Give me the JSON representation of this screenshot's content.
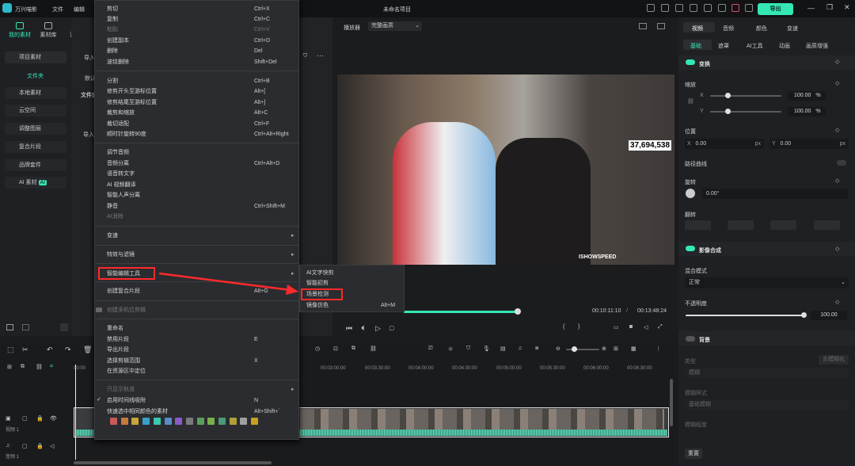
{
  "app": {
    "name": "万兴喵影",
    "menu_file": "文件",
    "menu_edit": "编辑",
    "project_title": "未命名项目",
    "export_label": "导出"
  },
  "left": {
    "tabs": [
      "我的素材",
      "素材库",
      "音频"
    ],
    "section": "项目素材",
    "folder": "文件夹",
    "items": [
      "本地素材",
      "云空间",
      "调整图层",
      "复合片段",
      "品牌套件",
      "AI 素材"
    ],
    "ai_badge": "AI"
  },
  "mid": {
    "import_label": "导入",
    "default_label": "默认",
    "folder_label": "文件夹",
    "import_btn": "导入"
  },
  "player": {
    "label": "播放器",
    "quality": "完整画质",
    "current_time": "00:10:11:10",
    "total_time": "00:13:48:24",
    "overlay_count": "37,694,538",
    "watermark": "ISHOWSPEED"
  },
  "right": {
    "tabs": [
      "视频",
      "音频",
      "颜色",
      "变速"
    ],
    "subtabs": [
      "基础",
      "遮罩",
      "AI工具",
      "动画",
      "画质增强"
    ],
    "transform": "变换",
    "scale": "缩放",
    "x_label": "X",
    "y_label": "Y",
    "scale_x": "100.00",
    "scale_y": "100.00",
    "pct": "%",
    "position": "位置",
    "pos_x": "0.00",
    "pos_y": "0.00",
    "px": "px",
    "path_curve": "路径曲线",
    "rotate": "旋转",
    "rotate_val": "0.00°",
    "flip": "翻转",
    "blend": "影像合成",
    "blend_mode_label": "混合模式",
    "blend_mode": "正常",
    "opacity_label": "不透明度",
    "opacity": "100.00",
    "opacity_frac": 1.0,
    "scale_frac": 0.25,
    "background": "背景",
    "bg_type": "类型",
    "bg_type_val": "模糊",
    "bg_type_btn": "去模糊化",
    "bg_style_label": "模糊样式",
    "bg_style": "基础模糊",
    "bg_level": "模糊程度",
    "reset": "重置"
  },
  "timeline": {
    "ruler": [
      "00:00",
      "00:03:00:00",
      "00:03:30:00",
      "00:04:00:00",
      "00:04:30:00",
      "00:05:00:00",
      "00:05:30:00",
      "00:06:00:00",
      "00:06:30:00"
    ],
    "video_track": "视频 1",
    "audio_track": "音频 1"
  },
  "context_menu": {
    "items": [
      {
        "label": "剪切",
        "shortcut": "Ctrl+X",
        "disabled": false
      },
      {
        "label": "复制",
        "shortcut": "Ctrl+C",
        "disabled": false
      },
      {
        "label": "粘贴",
        "shortcut": "Ctrl+V",
        "disabled": true
      },
      {
        "label": "创建副本",
        "shortcut": "Ctrl+D",
        "disabled": false
      },
      {
        "label": "删除",
        "shortcut": "Del",
        "disabled": false
      },
      {
        "label": "波纹删除",
        "shortcut": "Shift+Del",
        "disabled": false
      },
      {
        "label": "分割",
        "shortcut": "Ctrl+B",
        "disabled": false
      },
      {
        "label": "修剪开头至游标位置",
        "shortcut": "Alt+[",
        "disabled": false
      },
      {
        "label": "修剪结尾至游标位置",
        "shortcut": "Alt+]",
        "disabled": false
      },
      {
        "label": "裁剪和缩放",
        "shortcut": "Alt+C",
        "disabled": false
      },
      {
        "label": "裁切适配",
        "shortcut": "Ctrl+F",
        "disabled": false
      },
      {
        "label": "顺时针旋转90度",
        "shortcut": "Ctrl+Alt+Right",
        "disabled": false
      },
      {
        "label": "调节音频",
        "shortcut": "",
        "disabled": false
      },
      {
        "label": "音频分离",
        "shortcut": "Ctrl+Alt+D",
        "disabled": false
      },
      {
        "label": "语音转文字",
        "shortcut": "",
        "disabled": false
      },
      {
        "label": "AI 视频翻译",
        "shortcut": "",
        "disabled": false
      },
      {
        "label": "智能人声分离",
        "shortcut": "",
        "disabled": false
      },
      {
        "label": "静音",
        "shortcut": "Ctrl+Shift+M",
        "disabled": false
      },
      {
        "label": "AI消除",
        "shortcut": "",
        "disabled": true
      },
      {
        "label": "变速",
        "shortcut": "",
        "disabled": false
      },
      {
        "label": "特效与滤镜",
        "shortcut": "",
        "disabled": false
      },
      {
        "label": "智能编辑工具",
        "shortcut": "",
        "disabled": false
      },
      {
        "label": "创建复合片段",
        "shortcut": "Alt+G",
        "disabled": false
      },
      {
        "label": "创建多机位剪辑",
        "shortcut": "",
        "disabled": true
      },
      {
        "label": "重命名",
        "shortcut": "",
        "disabled": false
      },
      {
        "label": "禁用片段",
        "shortcut": "E",
        "disabled": false
      },
      {
        "label": "导出片段",
        "shortcut": "",
        "disabled": false
      },
      {
        "label": "选择剪辑范围",
        "shortcut": "X",
        "disabled": false
      },
      {
        "label": "在资源区中定位",
        "shortcut": "",
        "disabled": false
      },
      {
        "label": "只显示轨道",
        "shortcut": "",
        "disabled": true
      },
      {
        "label": "启用时间线吸附",
        "shortcut": "N",
        "disabled": false
      },
      {
        "label": "快速选中相同颜色的素材",
        "shortcut": "Alt+Shift+`",
        "disabled": false
      }
    ]
  },
  "submenu": {
    "items": [
      "AI文字快剪",
      "智能初剪",
      "场景检测",
      "镜像仿色"
    ],
    "mirror_shortcut": "Alt+M"
  },
  "colors": {
    "accent": "#34e8b5",
    "highlight": "#ff2a2a",
    "swatches": [
      "#c85a5a",
      "#c87a3a",
      "#c8a43a",
      "#3aa0c8",
      "#3ac8b0",
      "#5a8ac8",
      "#8a5ac8",
      "#7a7a7a",
      "#5aa05a",
      "#7ab04a",
      "#4a9a7a",
      "#b0a03a",
      "#a0a0a0",
      "#c8a020"
    ]
  }
}
